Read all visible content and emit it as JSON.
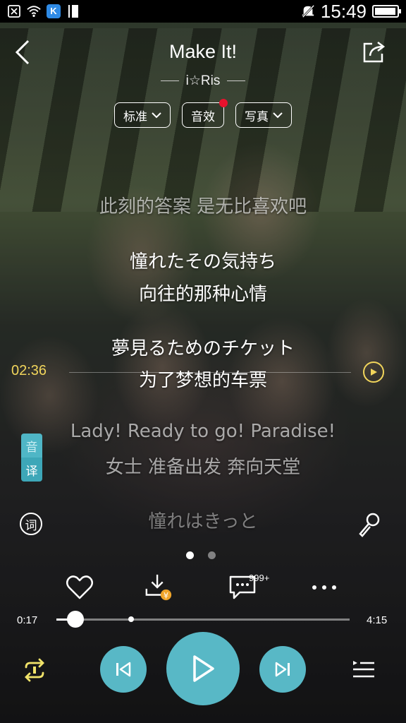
{
  "status_bar": {
    "time": "15:49",
    "icons": [
      "notification-x-icon",
      "wifi-icon",
      "k-app-icon",
      "bookmark-icon",
      "mute-icon",
      "battery-icon"
    ],
    "k_badge": "K",
    "battery_level": 0.95
  },
  "header": {
    "title": "Make It!",
    "artist": "i☆Ris",
    "back_icon": "chevron-left-icon",
    "share_icon": "share-icon"
  },
  "chips": {
    "quality": "标准",
    "effects": "音效",
    "photos": "写真"
  },
  "lyrics": {
    "line1": "此刻的答案 是无比喜欢吧",
    "line2": "憧れたその気持ち",
    "line3": "向往的那种心情",
    "line4": "夢見るためのチケット",
    "line5": "为了梦想的车票",
    "line6": "Lady! Ready to go! Paradise!",
    "line7": "女士 准备出发 奔向天堂",
    "line8": "憧れはきっと"
  },
  "seek_marker": {
    "time": "02:36"
  },
  "translate_toggle": {
    "top": "音",
    "bottom": "译"
  },
  "lyric_button": "词",
  "pager": {
    "pages": 2,
    "current": 0
  },
  "actions": {
    "comment_count": "999+",
    "download_badge": "¥"
  },
  "progress": {
    "current": "0:17",
    "total": "4:15",
    "played_fraction": 0.066,
    "buffered_fraction": 0.255
  },
  "colors": {
    "accent": "#58b8c6",
    "seek_marker": "#f1d55b",
    "repeat_icon": "#f1e36a",
    "effects_dot": "#e8122d",
    "download_badge": "#f0a52a"
  }
}
